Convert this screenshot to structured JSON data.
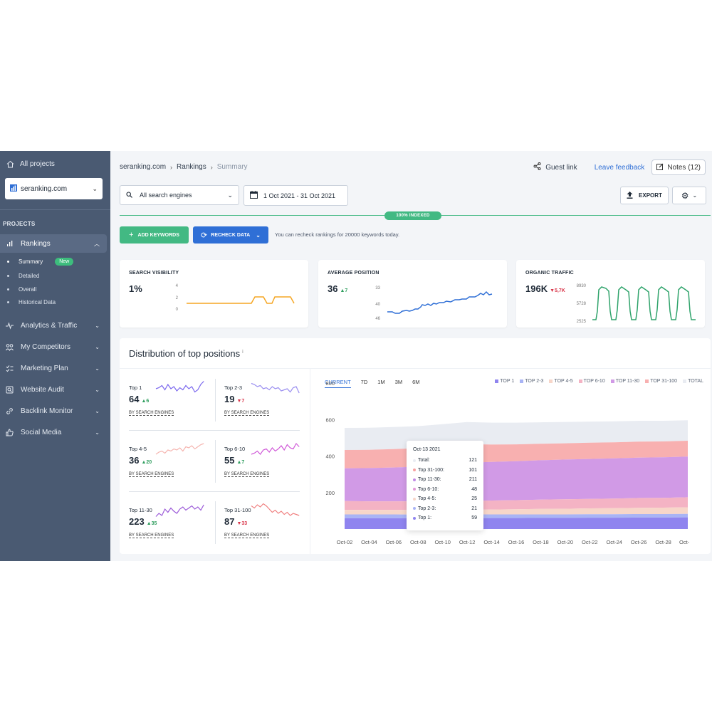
{
  "sidebar": {
    "all_projects": "All projects",
    "project": "seranking.com",
    "section_label": "PROJECTS",
    "rankings": "Rankings",
    "sub_items": [
      "Summary",
      "Detailed",
      "Overall",
      "Historical Data"
    ],
    "new_badge": "New",
    "items": [
      "Analytics & Traffic",
      "My Competitors",
      "Marketing Plan",
      "Website Audit",
      "Backlink Monitor",
      "Social Media"
    ]
  },
  "breadcrumb": [
    "seranking.com",
    "Rankings",
    "Summary"
  ],
  "header": {
    "guest_link": "Guest link",
    "leave_feedback": "Leave feedback",
    "notes": "Notes (12)"
  },
  "toolbar": {
    "engine": "All search engines",
    "date_range": "1 Oct 2021 - 31 Oct 2021",
    "export": "EXPORT",
    "indexed": "100% INDEXED",
    "add_keywords": "ADD KEYWORDS",
    "recheck": "RECHECK DATA",
    "recheck_note": "You can recheck rankings for 20000 keywords today."
  },
  "kpis": {
    "visibility": {
      "title": "SEARCH VISIBILITY",
      "value": "1%",
      "y_ticks": [
        "4",
        "2",
        "0"
      ]
    },
    "avg_position": {
      "title": "AVERAGE POSITION",
      "value": "36",
      "delta": "7",
      "y_ticks": [
        "33",
        "40",
        "46"
      ]
    },
    "organic": {
      "title": "ORGANIC TRAFFIC",
      "value": "196K",
      "delta": "5,7K",
      "y_ticks": [
        "8930",
        "5728",
        "2525"
      ]
    }
  },
  "distribution": {
    "title": "Distribution of top positions",
    "info": "i",
    "link_label": "BY SEARCH ENGINES",
    "minis": [
      {
        "label": "Top 1",
        "value": "64",
        "delta": "6",
        "dir": "up",
        "color": "#7b68ee"
      },
      {
        "label": "Top 2-3",
        "value": "19",
        "delta": "7",
        "dir": "down",
        "color": "#9a8ef0"
      },
      {
        "label": "Top 4-5",
        "value": "36",
        "delta": "20",
        "dir": "up",
        "color": "#f5b5b0"
      },
      {
        "label": "Top 6-10",
        "value": "55",
        "delta": "7",
        "dir": "up",
        "color": "#d05ad8"
      },
      {
        "label": "Top 11-30",
        "value": "223",
        "delta": "35",
        "dir": "up",
        "color": "#9b5ad8"
      },
      {
        "label": "Top 31-100",
        "value": "87",
        "delta": "33",
        "dir": "down",
        "color": "#f08080"
      }
    ],
    "tabs": [
      "CURRENT",
      "7D",
      "1M",
      "3M",
      "6M"
    ],
    "legend": [
      {
        "name": "TOP 1",
        "color": "#8f84ef"
      },
      {
        "name": "TOP 2-3",
        "color": "#a9b4f5"
      },
      {
        "name": "TOP 4-5",
        "color": "#f7d6c9"
      },
      {
        "name": "TOP 6-10",
        "color": "#f4b3c4"
      },
      {
        "name": "TOP 11-30",
        "color": "#d19ae6"
      },
      {
        "name": "TOP 31-100",
        "color": "#f8b0b0"
      },
      {
        "name": "TOTAL",
        "color": "#e9ecf2"
      }
    ],
    "tooltip": {
      "date": "Oct-13 2021",
      "rows": [
        {
          "label": "Total:",
          "value": "121",
          "color": "#e9ecf2"
        },
        {
          "label": "Top 31-100:",
          "value": "101",
          "color": "#f8a0a0"
        },
        {
          "label": "Top 11-30:",
          "value": "211",
          "color": "#c18ae6"
        },
        {
          "label": "Top 6-10:",
          "value": "48",
          "color": "#e39ad8"
        },
        {
          "label": "Top 4-5:",
          "value": "25",
          "color": "#f7d6c9"
        },
        {
          "label": "Top 2-3:",
          "value": "21",
          "color": "#a9b4f5"
        },
        {
          "label": "Top 1:",
          "value": "59",
          "color": "#8f84ef"
        }
      ]
    }
  },
  "chart_data": {
    "type": "area",
    "x": [
      "Oct-02",
      "Oct-04",
      "Oct-06",
      "Oct-08",
      "Oct-10",
      "Oct-12",
      "Oct-14",
      "Oct-16",
      "Oct-18",
      "Oct-20",
      "Oct-22",
      "Oct-24",
      "Oct-26",
      "Oct-28",
      "Oct-"
    ],
    "y_ticks": [
      800,
      600,
      400,
      200
    ],
    "ylim": [
      0,
      800
    ],
    "series": [
      {
        "name": "TOP 1",
        "values": [
          59,
          59,
          59,
          59,
          59,
          59,
          60,
          60,
          61,
          61,
          62,
          62,
          63,
          63,
          64
        ]
      },
      {
        "name": "TOP 2-3",
        "values": [
          21,
          21,
          21,
          20,
          21,
          21,
          20,
          20,
          19,
          19,
          19,
          19,
          19,
          19,
          19
        ]
      },
      {
        "name": "TOP 4-5",
        "values": [
          25,
          25,
          24,
          25,
          25,
          25,
          27,
          28,
          30,
          31,
          32,
          33,
          34,
          35,
          36
        ]
      },
      {
        "name": "TOP 6-10",
        "values": [
          48,
          47,
          48,
          48,
          48,
          48,
          49,
          50,
          51,
          52,
          52,
          53,
          54,
          54,
          55
        ]
      },
      {
        "name": "TOP 11-30",
        "values": [
          180,
          182,
          185,
          190,
          200,
          211,
          212,
          214,
          216,
          218,
          219,
          220,
          221,
          222,
          223
        ]
      },
      {
        "name": "TOP 31-100",
        "values": [
          100,
          100,
          101,
          101,
          101,
          101,
          95,
          92,
          90,
          89,
          89,
          88,
          88,
          87,
          87
        ]
      },
      {
        "name": "TOTAL",
        "values": [
          121,
          121,
          121,
          121,
          121,
          121,
          120,
          119,
          118,
          117,
          116,
          115,
          114,
          113,
          112
        ]
      }
    ]
  }
}
